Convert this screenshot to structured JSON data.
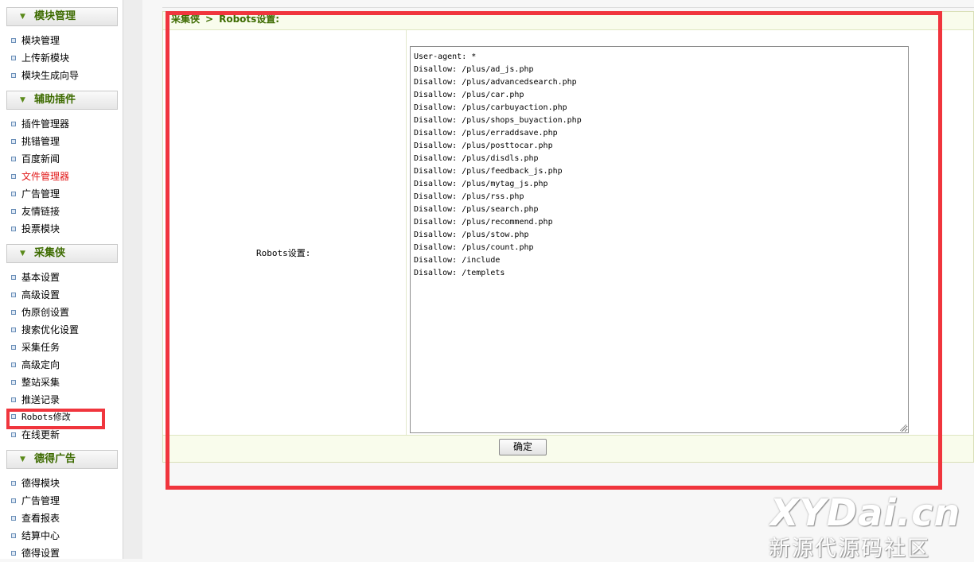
{
  "sidebar": {
    "groups": [
      {
        "title": "模块管理",
        "items": [
          "模块管理",
          "上传新模块",
          "模块生成向导"
        ]
      },
      {
        "title": "辅助插件",
        "items": [
          "插件管理器",
          "挑错管理",
          "百度新闻",
          "文件管理器",
          "广告管理",
          "友情链接",
          "投票模块"
        ]
      },
      {
        "title": "采集侠",
        "items": [
          "基本设置",
          "高级设置",
          "伪原创设置",
          "搜索优化设置",
          "采集任务",
          "高级定向",
          "整站采集",
          "推送记录",
          "Robots修改",
          "在线更新"
        ]
      },
      {
        "title": "德得广告",
        "items": [
          "德得模块",
          "广告管理",
          "查看报表",
          "结算中心",
          "德得设置"
        ]
      }
    ]
  },
  "main": {
    "breadcrumb": {
      "root": "采集侠",
      "separator": ">",
      "current": "Robots设置:"
    },
    "robots_label": "Robots设置:",
    "robots_content": "User-agent: *\nDisallow: /plus/ad_js.php\nDisallow: /plus/advancedsearch.php\nDisallow: /plus/car.php\nDisallow: /plus/carbuyaction.php\nDisallow: /plus/shops_buyaction.php\nDisallow: /plus/erraddsave.php\nDisallow: /plus/posttocar.php\nDisallow: /plus/disdls.php\nDisallow: /plus/feedback_js.php\nDisallow: /plus/mytag_js.php\nDisallow: /plus/rss.php\nDisallow: /plus/search.php\nDisallow: /plus/recommend.php\nDisallow: /plus/stow.php\nDisallow: /plus/count.php\nDisallow: /include\nDisallow: /templets",
    "confirm_label": "确定"
  },
  "watermark": {
    "brand": "XYDai.cn",
    "tagline": "新源代源码社区"
  },
  "colors": {
    "group_title": "#3d6b00",
    "active_item": "#e21a1a",
    "highlight": "#f0353d"
  }
}
